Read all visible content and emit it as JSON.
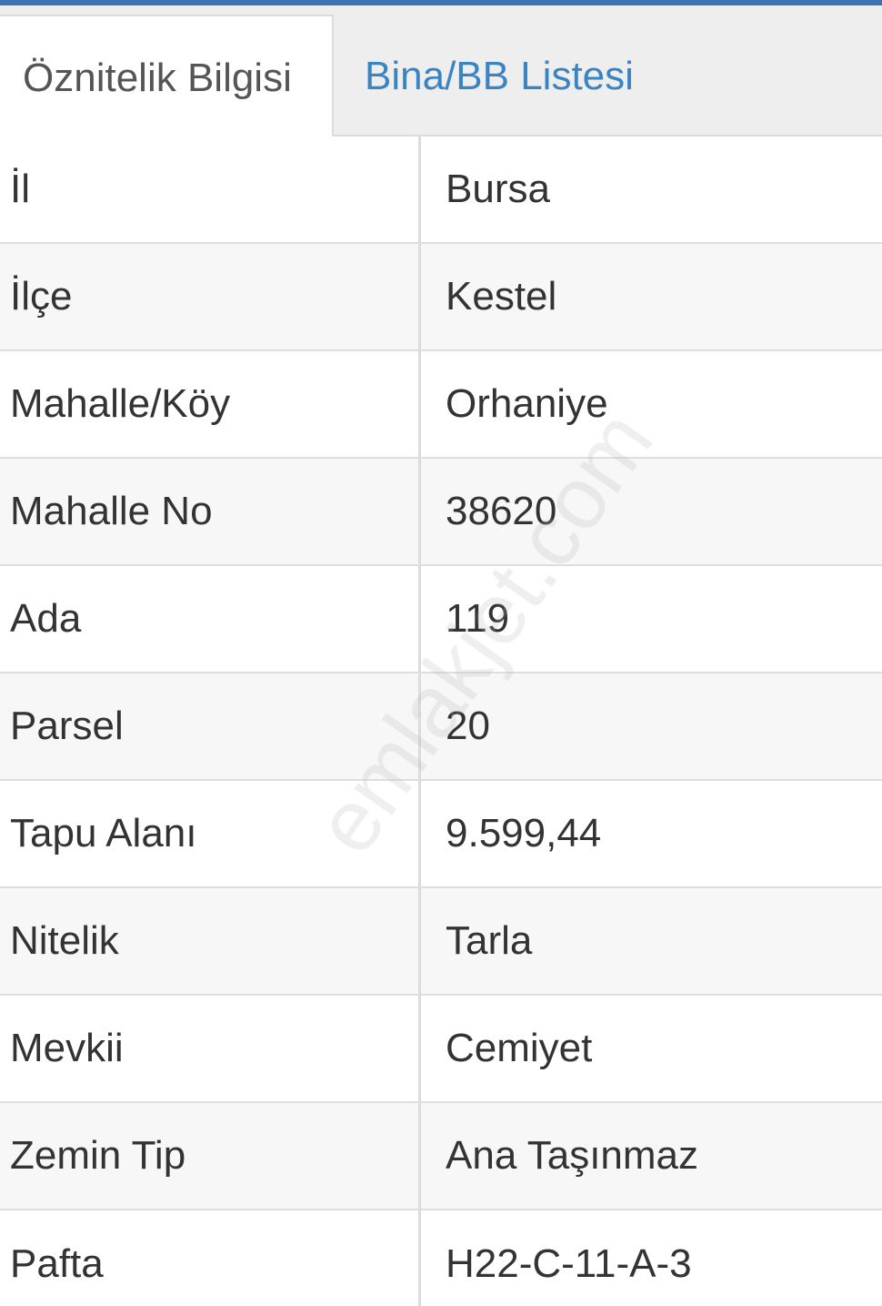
{
  "tabs": [
    {
      "label": "Öznitelik Bilgisi",
      "active": true
    },
    {
      "label": "Bina/BB Listesi",
      "active": false
    }
  ],
  "rows": [
    {
      "label": "İl",
      "value": "Bursa"
    },
    {
      "label": "İlçe",
      "value": "Kestel"
    },
    {
      "label": "Mahalle/Köy",
      "value": "Orhaniye"
    },
    {
      "label": "Mahalle No",
      "value": "38620"
    },
    {
      "label": "Ada",
      "value": "119"
    },
    {
      "label": "Parsel",
      "value": "20"
    },
    {
      "label": "Tapu Alanı",
      "value": "9.599,44"
    },
    {
      "label": "Nitelik",
      "value": "Tarla"
    },
    {
      "label": "Mevkii",
      "value": "Cemiyet"
    },
    {
      "label": "Zemin Tip",
      "value": "Ana Taşınmaz"
    },
    {
      "label": "Pafta",
      "value": "H22-C-11-A-3"
    }
  ],
  "watermark": "emlakjet.com",
  "colors": {
    "accent": "#3b73b0",
    "tab_link": "#3a84c4",
    "text": "#333333"
  }
}
